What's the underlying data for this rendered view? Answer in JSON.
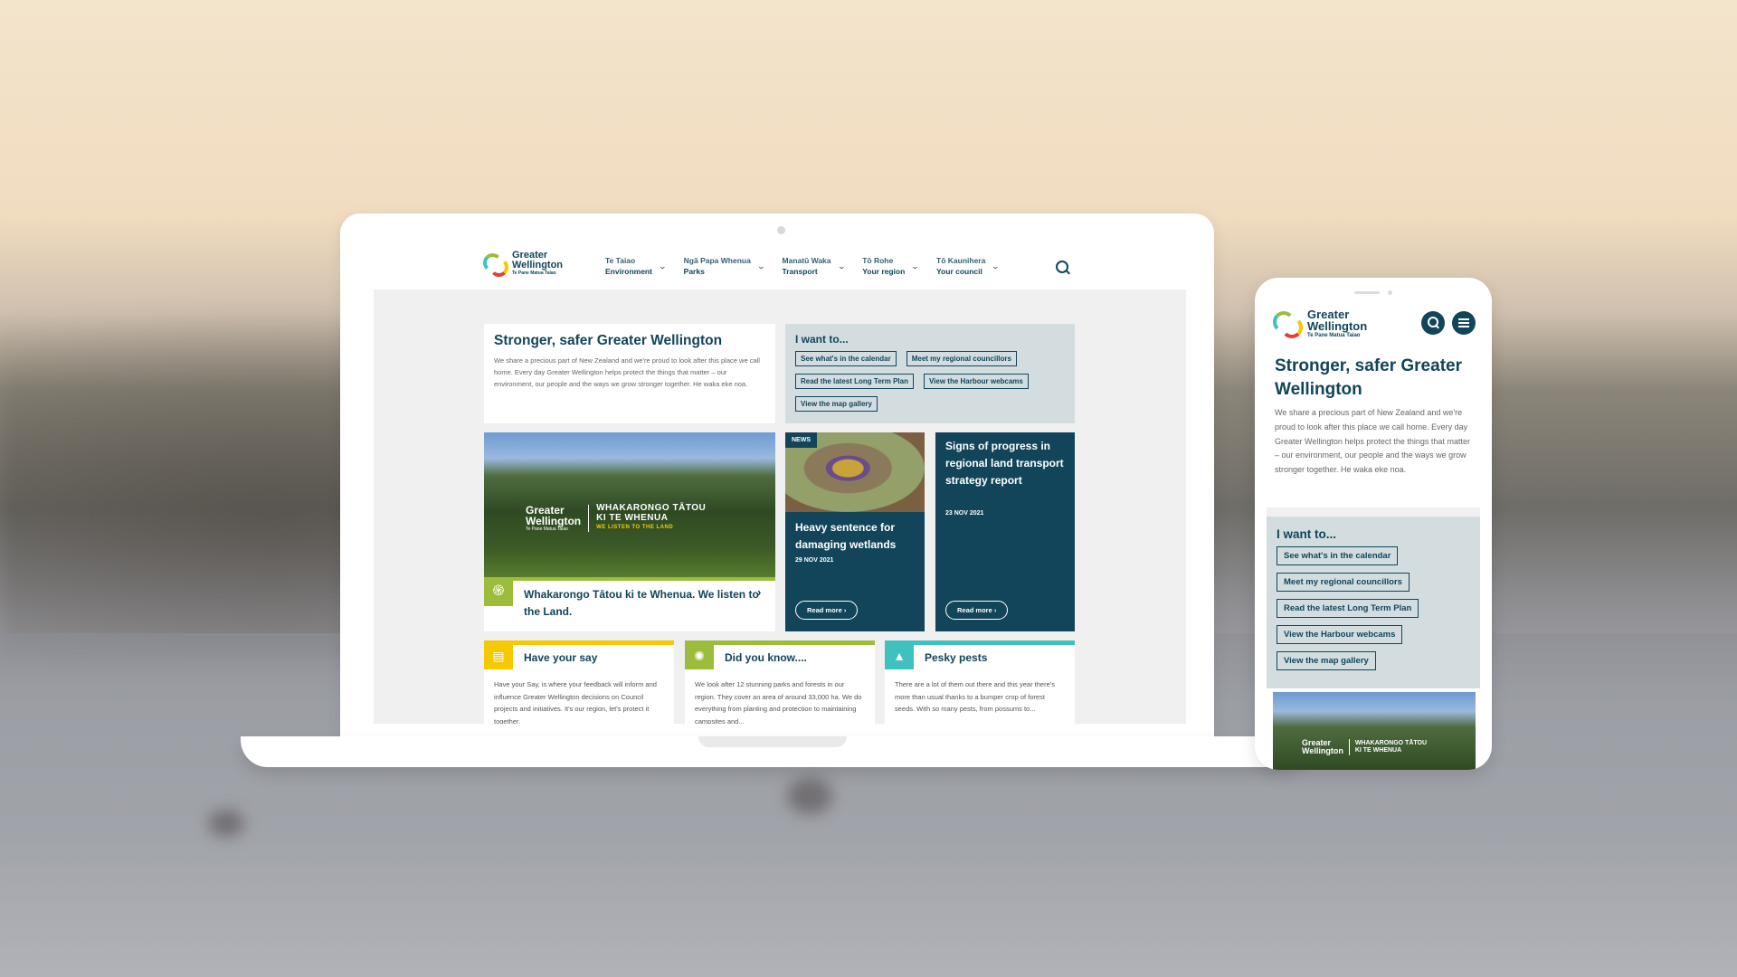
{
  "colors": {
    "primary": "#124559",
    "green": "#9cbd3b",
    "yellow": "#f5c800",
    "teal": "#3fc1c0",
    "panel": "#d3dde0"
  },
  "brand": {
    "line1": "Greater",
    "line2": "Wellington",
    "line3": "Te Pane Matua Taiao"
  },
  "nav": {
    "items": [
      {
        "maori": "Te Taiao",
        "english": "Environment"
      },
      {
        "maori": "Ngā Papa Whenua",
        "english": "Parks"
      },
      {
        "maori": "Manatū Waka",
        "english": "Transport"
      },
      {
        "maori": "Tō Rohe",
        "english": "Your region"
      },
      {
        "maori": "Tō Kaunihera",
        "english": "Your council"
      }
    ],
    "search_icon": "search-icon",
    "chevron": "⌄"
  },
  "intro": {
    "title": "Stronger, safer Greater Wellington",
    "body": "We share a precious part of New Zealand and we're proud to look after this place we call home. Every day Greater Wellington helps protect the things that matter – our environment, our people and the ways we grow stronger together. He waka eke noa."
  },
  "iwant": {
    "title": "I want to...",
    "links": [
      "See what's in the calendar",
      "Meet my regional councillors",
      "Read the latest Long Term Plan",
      "View the Harbour webcams",
      "View the map gallery"
    ]
  },
  "hero": {
    "overlay_brand1": "Greater",
    "overlay_brand2": "Wellington",
    "overlay_brand3": "Te Pane Matua Taiao",
    "overlay_title1": "WHAKARONGO TĀTOU",
    "overlay_title2": "KI TE WHENUA",
    "overlay_sub": "WE LISTEN TO THE LAND",
    "caption": "Whakarongo Tātou ki te Whenua. We listen to the Land.",
    "chevron": "›"
  },
  "news": [
    {
      "tag": "NEWS",
      "title": "Heavy sentence for damaging wetlands",
      "date": "29 NOV 2021",
      "cta": "Read more ›"
    },
    {
      "title": "Signs of progress in regional land transport strategy report",
      "date": "23 NOV 2021",
      "cta": "Read more ›"
    }
  ],
  "promos": [
    {
      "title": "Have your say",
      "body": "Have your Say, is where your feedback will inform and influence Greater Wellington decisions on Council projects and initiatives. It's our region, let's protect it together.",
      "icon": "▤"
    },
    {
      "title": "Did you know....",
      "body": "We look after 12 stunning parks and forests in our region. They cover an area of around 33,000 ha. We do everything from planting and protection to maintaining campsites and...",
      "icon": "✺"
    },
    {
      "title": "Pesky pests",
      "body": "There are a lot of them out there and this year there's more than usual thanks to a bumper crop of forest seeds. With so many pests, from possums to...",
      "icon": "▲"
    }
  ]
}
